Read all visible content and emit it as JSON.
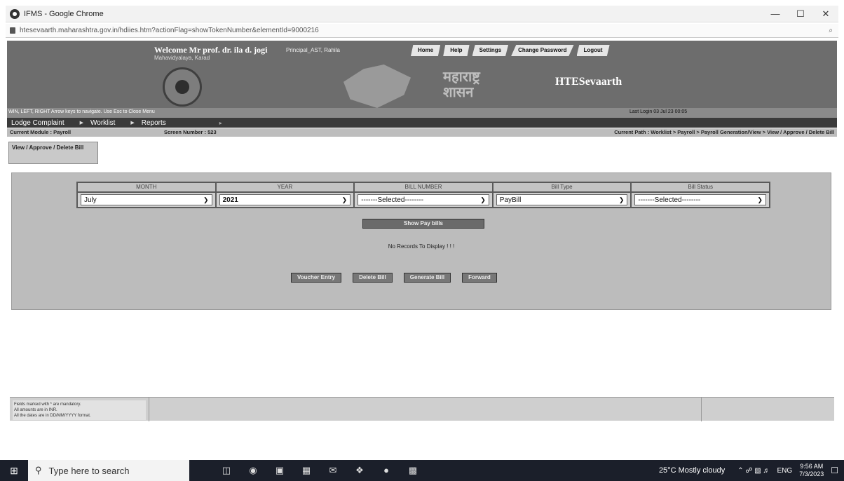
{
  "browser": {
    "tab_title": "IFMS - Google Chrome",
    "url": "htesevaarth.maharashtra.gov.in/hdiies.htm?actionFlag=showTokenNumber&elementId=9000216",
    "window_buttons": [
      "—",
      "☐",
      "✕"
    ],
    "zoom_icon": "⌕"
  },
  "header": {
    "welcome": "Welcome Mr prof. dr. ila d. jogi",
    "welcome_sub": "Mahavidyalaya, Karad",
    "role": "Principal_AST, Rahila",
    "nav": [
      "Home",
      "Help",
      "Settings",
      "Change Password",
      "Logout"
    ],
    "marathi_line1": "महाराष्ट्र",
    "marathi_line2": "शासन",
    "brand": "HTESevaarth",
    "hint": "WIN, LEFT, RIGHT Arrow keys to navigate. Use Esc to Close Menu",
    "last_login": "Last Login 03 Jul 23 00:05"
  },
  "menu": {
    "items": [
      "Lodge Complaint",
      "Worklist",
      "Reports"
    ]
  },
  "module_bar": {
    "current_module": "Current Module : Payroll",
    "screen_number": "Screen Number : 523",
    "current_path": "Current Path : Worklist > Payroll > Payroll Generation/View > View / Approve / Delete Bill"
  },
  "page_tab": "View / Approve / Delete Bill",
  "filters": [
    {
      "header": "MONTH",
      "value": "July"
    },
    {
      "header": "YEAR",
      "value": "2021"
    },
    {
      "header": "BILL NUMBER",
      "value": "-------Selected--------"
    },
    {
      "header": "Bill Type",
      "value": "PayBill"
    },
    {
      "header": "Bill Status",
      "value": "-------Selected--------"
    }
  ],
  "show_button": "Show Pay bills",
  "no_records": "No Records To Display ! ! !",
  "actions": [
    "Voucher Entry",
    "Delete Bill",
    "Generate Bill",
    "Forward"
  ],
  "footer_notes": [
    "Fields marked with * are mandatory.",
    "All amounts are in INR.",
    "All the dates are in DD/MM/YYYY format."
  ],
  "taskbar": {
    "search_placeholder": "Type here to search",
    "weather": "25°C  Mostly cloudy",
    "language": "ENG",
    "time": "9:56 AM",
    "date": "7/3/2023"
  }
}
